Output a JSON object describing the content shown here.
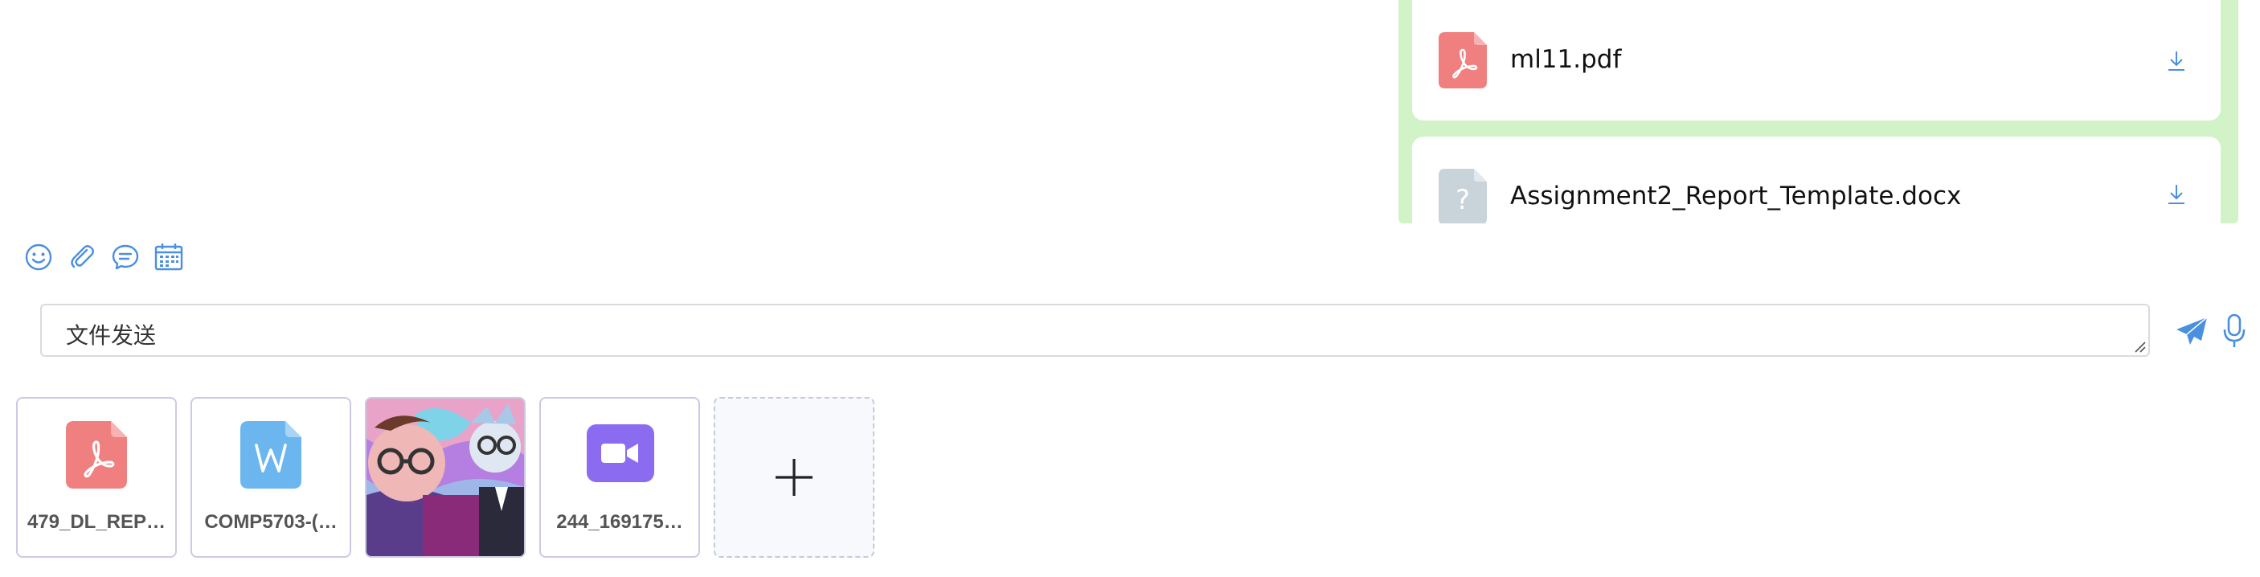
{
  "messages": {
    "files": [
      {
        "name": "ml11.pdf",
        "type": "pdf"
      },
      {
        "name": "Assignment2_Report_Template.docx",
        "type": "unknown"
      }
    ]
  },
  "toolbar": {
    "icons": [
      "emoji-icon",
      "attachment-icon",
      "chat-bubble-icon",
      "calendar-icon"
    ]
  },
  "composer": {
    "value": "文件发送"
  },
  "attachments": [
    {
      "name": "479_DL_REP…",
      "type": "pdf",
      "color": "#f08080"
    },
    {
      "name": "COMP5703-(…",
      "type": "word",
      "color": "#6cb6f0"
    },
    {
      "name": "",
      "type": "image"
    },
    {
      "name": "244_169175…",
      "type": "video",
      "color": "#8b6cf0"
    }
  ],
  "colors": {
    "accent": "#4a8fe0",
    "bubble_green": "#d2f2c8",
    "pdf_red": "#f08080",
    "word_blue": "#6cb6f0",
    "video_purple": "#8b6cf0",
    "unknown_gray": "#c9d3da"
  }
}
